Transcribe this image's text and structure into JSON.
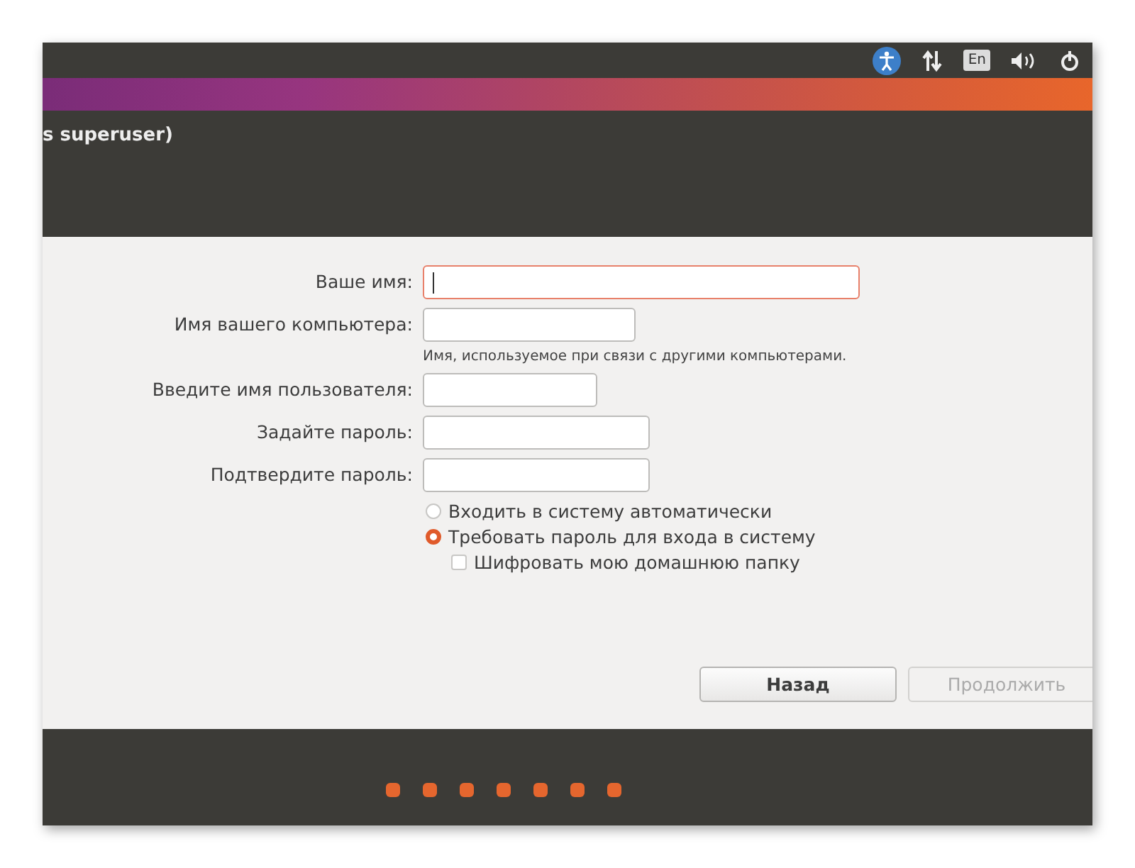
{
  "top_panel": {
    "keyboard_layout": "En"
  },
  "header": {
    "title": "s superuser)"
  },
  "fields": [
    {
      "label": "Ваше имя:",
      "focused": true
    },
    {
      "label": "Имя вашего компьютера:",
      "focused": false,
      "hint": "Имя, используемое при связи с другими компьютерами."
    },
    {
      "label": "Введите имя пользователя:",
      "focused": false
    },
    {
      "label": "Задайте пароль:",
      "focused": false
    },
    {
      "label": "Подтвердите пароль:",
      "focused": false
    }
  ],
  "login_options": [
    {
      "label": "Входить в систему автоматически",
      "selected": false
    },
    {
      "label": "Требовать пароль для входа в систему",
      "selected": true
    }
  ],
  "encrypt_home": {
    "label": "Шифровать мою домашнюю папку",
    "checked": false
  },
  "buttons": [
    {
      "label": "Назад",
      "disabled": false
    },
    {
      "label": "Продолжить",
      "disabled": true
    }
  ],
  "steps": [
    {
      "done": true
    },
    {
      "done": true
    },
    {
      "done": true
    },
    {
      "done": true
    },
    {
      "done": true
    },
    {
      "done": true
    },
    {
      "done": true
    }
  ]
}
